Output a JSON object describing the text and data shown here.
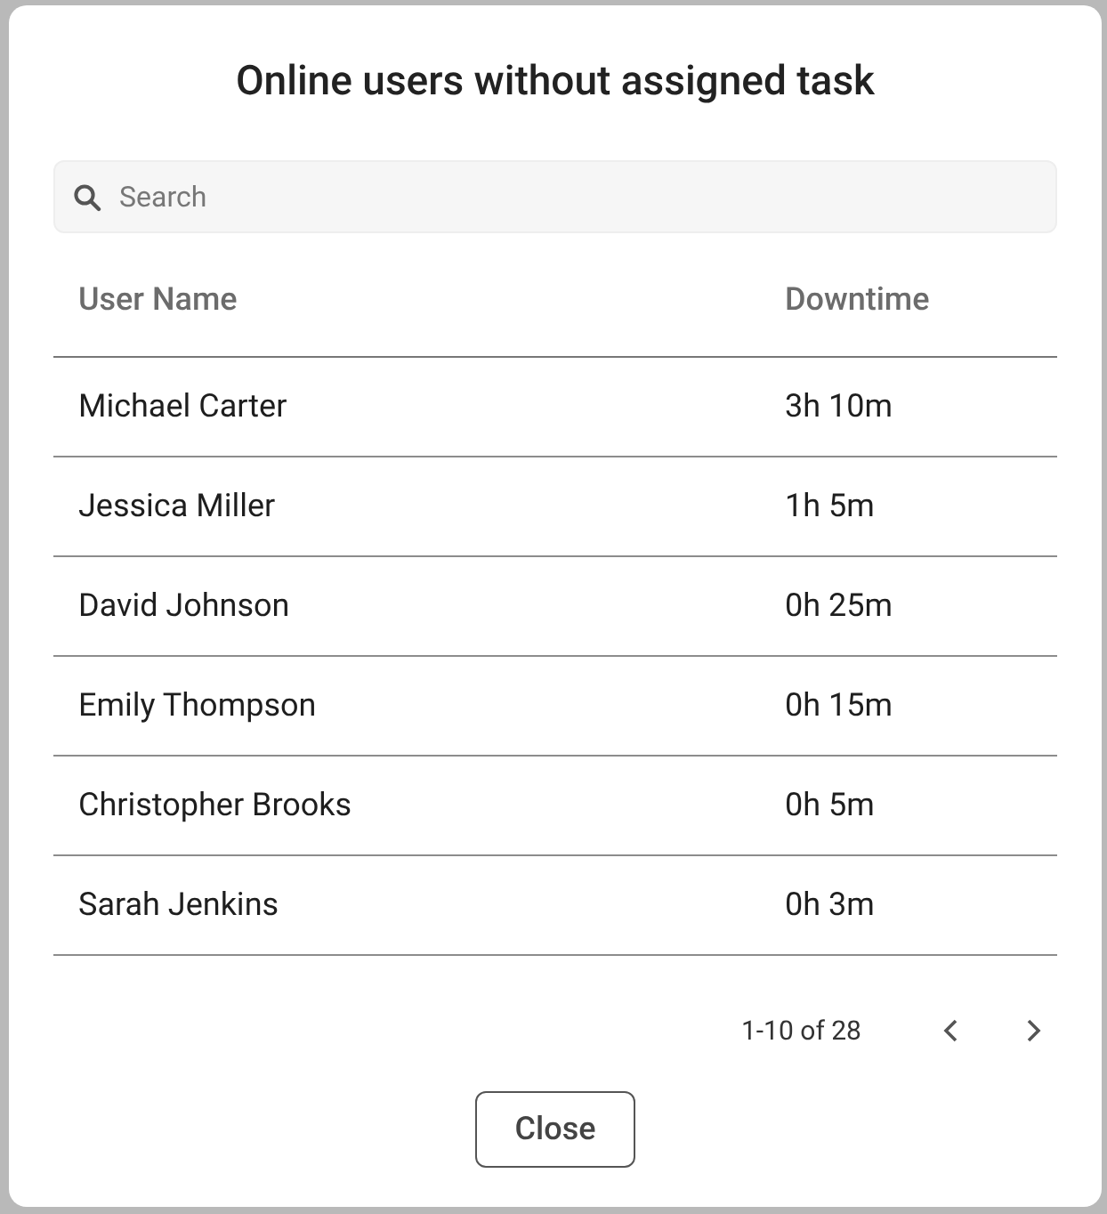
{
  "dialog": {
    "title": "Online users without assigned task"
  },
  "search": {
    "placeholder": "Search"
  },
  "table": {
    "columns": [
      "User Name",
      "Downtime"
    ],
    "rows": [
      [
        "Michael Carter",
        "3h 10m"
      ],
      [
        "Jessica Miller",
        "1h 5m"
      ],
      [
        "David Johnson",
        "0h 25m"
      ],
      [
        "Emily Thompson",
        "0h 15m"
      ],
      [
        "Christopher Brooks",
        "0h 5m"
      ],
      [
        "Sarah Jenkins",
        "0h 3m"
      ]
    ]
  },
  "pagination": {
    "range": "1-10 of 28"
  },
  "buttons": [
    "Close"
  ]
}
